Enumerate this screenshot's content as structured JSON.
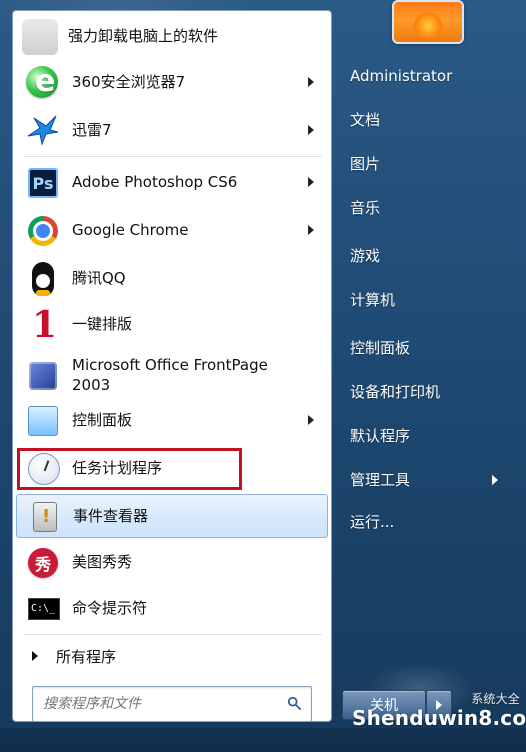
{
  "start_menu": {
    "left_items": [
      {
        "label": "强力卸载电脑上的软件",
        "has_arrow": false,
        "icon": "blurred-app-icon"
      },
      {
        "label": "360安全浏览器7",
        "has_arrow": true,
        "icon": "browser-e-icon"
      },
      {
        "label": "迅雷7",
        "has_arrow": true,
        "icon": "thunder-bird-icon"
      },
      {
        "label": "Adobe Photoshop CS6",
        "has_arrow": true,
        "icon": "photoshop-icon"
      },
      {
        "label": "Google Chrome",
        "has_arrow": true,
        "icon": "chrome-icon"
      },
      {
        "label": "腾讯QQ",
        "has_arrow": false,
        "icon": "qq-penguin-icon"
      },
      {
        "label": "一键排版",
        "has_arrow": false,
        "icon": "number-one-icon"
      },
      {
        "label_line1": "Microsoft Office FrontPage",
        "label_line2": "2003",
        "has_arrow": false,
        "icon": "frontpage-icon"
      },
      {
        "label": "控制面板",
        "has_arrow": true,
        "icon": "control-panel-icon"
      },
      {
        "label": "任务计划程序",
        "has_arrow": false,
        "icon": "clock-icon"
      },
      {
        "label": "事件查看器",
        "has_arrow": false,
        "icon": "event-viewer-icon",
        "selected": true
      },
      {
        "label": "美图秀秀",
        "has_arrow": false,
        "icon": "meitu-icon"
      },
      {
        "label": "命令提示符",
        "has_arrow": false,
        "icon": "command-prompt-icon"
      }
    ],
    "all_programs": {
      "label": "所有程序",
      "icon": "triangle-right-icon"
    },
    "search": {
      "placeholder": "搜索程序和文件",
      "icon": "search-icon"
    },
    "right_items": [
      {
        "label": "Administrator",
        "has_arrow": false
      },
      {
        "label": "文档",
        "has_arrow": false
      },
      {
        "label": "图片",
        "has_arrow": false
      },
      {
        "label": "音乐",
        "has_arrow": false
      },
      {
        "label": "游戏",
        "has_arrow": false
      },
      {
        "label": "计算机",
        "has_arrow": false
      },
      {
        "label": "控制面板",
        "has_arrow": false
      },
      {
        "label": "设备和打印机",
        "has_arrow": false
      },
      {
        "label": "默认程序",
        "has_arrow": false
      },
      {
        "label": "管理工具",
        "has_arrow": true
      },
      {
        "label": "运行...",
        "has_arrow": false
      }
    ],
    "shutdown": {
      "label": "关机",
      "icon": "chevron-right-icon"
    },
    "watermark": {
      "text": "Shenduwin8.com",
      "small": "系统大全"
    },
    "colors": {
      "accent_border": "#c1121f",
      "pane_border": "#7f9db9",
      "right_pane_text": "#ffffff"
    }
  }
}
